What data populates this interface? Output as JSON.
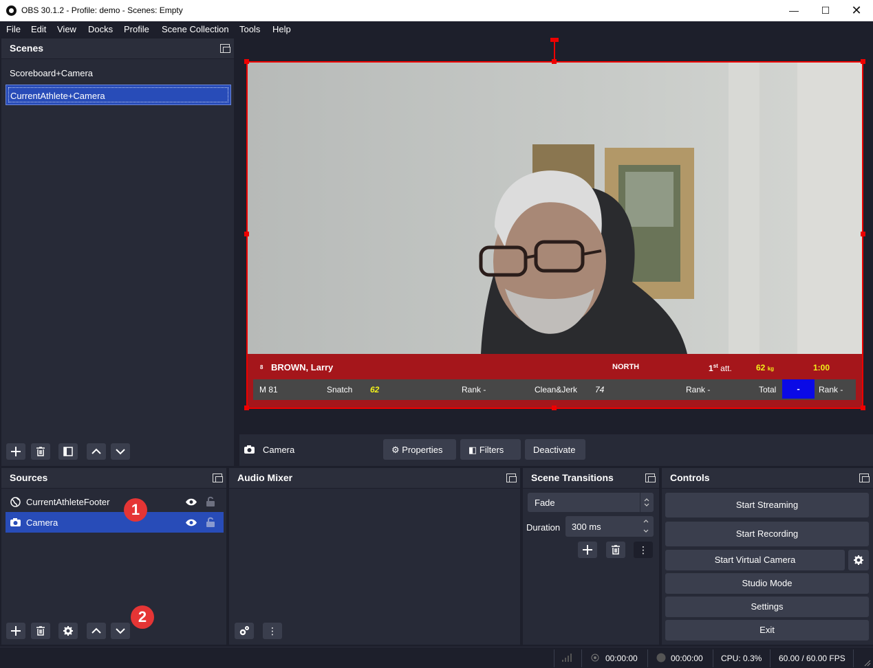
{
  "window": {
    "title": "OBS 30.1.2 - Profile: demo - Scenes: Empty"
  },
  "menu": [
    "File",
    "Edit",
    "View",
    "Docks",
    "Profile",
    "Scene Collection",
    "Tools",
    "Help"
  ],
  "scenes": {
    "title": "Scenes",
    "items": [
      "Scoreboard+Camera",
      "CurrentAthlete+Camera"
    ],
    "selected_index": 1
  },
  "sources": {
    "title": "Sources",
    "items": [
      {
        "label": "CurrentAthleteFooter",
        "icon": "browser-globe-icon"
      },
      {
        "label": "Camera",
        "icon": "camera-icon"
      }
    ],
    "selected_index": 1
  },
  "audio_mixer": {
    "title": "Audio Mixer"
  },
  "transitions": {
    "title": "Scene Transitions",
    "type": "Fade",
    "duration_label": "Duration",
    "duration_value": "300 ms"
  },
  "controls": {
    "title": "Controls",
    "start_streaming": "Start Streaming",
    "start_recording": "Start Recording",
    "start_virtual_camera": "Start Virtual Camera",
    "studio_mode": "Studio Mode",
    "settings": "Settings",
    "exit": "Exit"
  },
  "source_toolbar": {
    "source_name": "Camera",
    "properties": "Properties",
    "filters": "Filters",
    "deactivate": "Deactivate"
  },
  "footer_overlay": {
    "start_number": "8",
    "athlete": "BROWN, Larry",
    "team": "NORTH",
    "attempt_num": "1",
    "attempt_sup": "st",
    "attempt_suffix": "att.",
    "weight": "62",
    "weight_unit": "kg",
    "clock": "1:00",
    "category": "M 81",
    "snatch_label": "Snatch",
    "snatch_value": "62",
    "snatch_rank": "Rank -",
    "cj_label": "Clean&Jerk",
    "cj_value": "74",
    "cj_rank": "Rank -",
    "total_label": "Total",
    "total_value": "-",
    "total_rank": "Rank -"
  },
  "status": {
    "stream_time": "00:00:00",
    "record_time": "00:00:00",
    "cpu": "CPU: 0.3%",
    "fps": "60.00 / 60.00 FPS"
  },
  "badges": [
    "1",
    "2"
  ],
  "colors": {
    "background": "#1d1f2b",
    "panel": "#272a37",
    "selection": "#284cb8",
    "button": "#3a3e4d",
    "footer_red": "#a5161b",
    "footer_total_blue": "#0a0ae6",
    "highlight_yellow": "#f1f11a",
    "badge_red": "#e53535"
  }
}
